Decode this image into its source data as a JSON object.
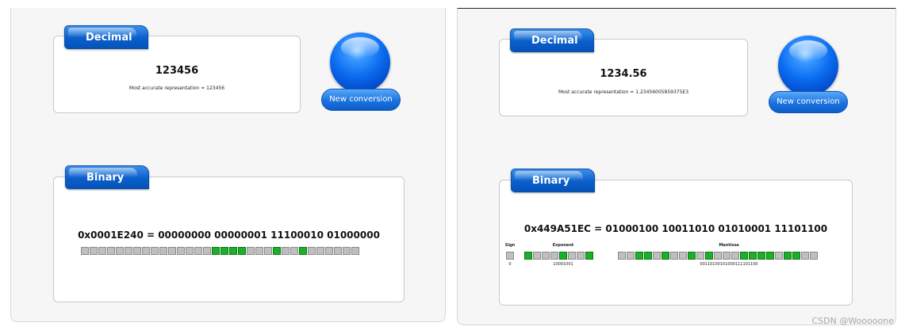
{
  "left": {
    "decimal_tab": "Decimal",
    "decimal_value": "123456",
    "decimal_note": "Most accurate representation = 123456",
    "new_conversion": "New conversion",
    "binary_tab": "Binary",
    "binary_equation": "0x0001E240 = 00000000 00000001 11100010 01000000",
    "bits": "00000000000000011110001001000000"
  },
  "right": {
    "decimal_tab": "Decimal",
    "decimal_value": "1234.56",
    "decimal_note": "Most accurate representation = 1.23456005859375E3",
    "new_conversion": "New conversion",
    "binary_tab": "Binary",
    "binary_equation": "0x449A51EC = 01000100 10011010 01010001 11101100",
    "sign_label": "Sign",
    "exponent_label": "Exponent",
    "mantissa_label": "Mantissa",
    "sign_bit": "0",
    "exponent_bits": "10001001",
    "mantissa_bits": "00110100101000111101100"
  },
  "watermark": "CSDN @Wooooone"
}
